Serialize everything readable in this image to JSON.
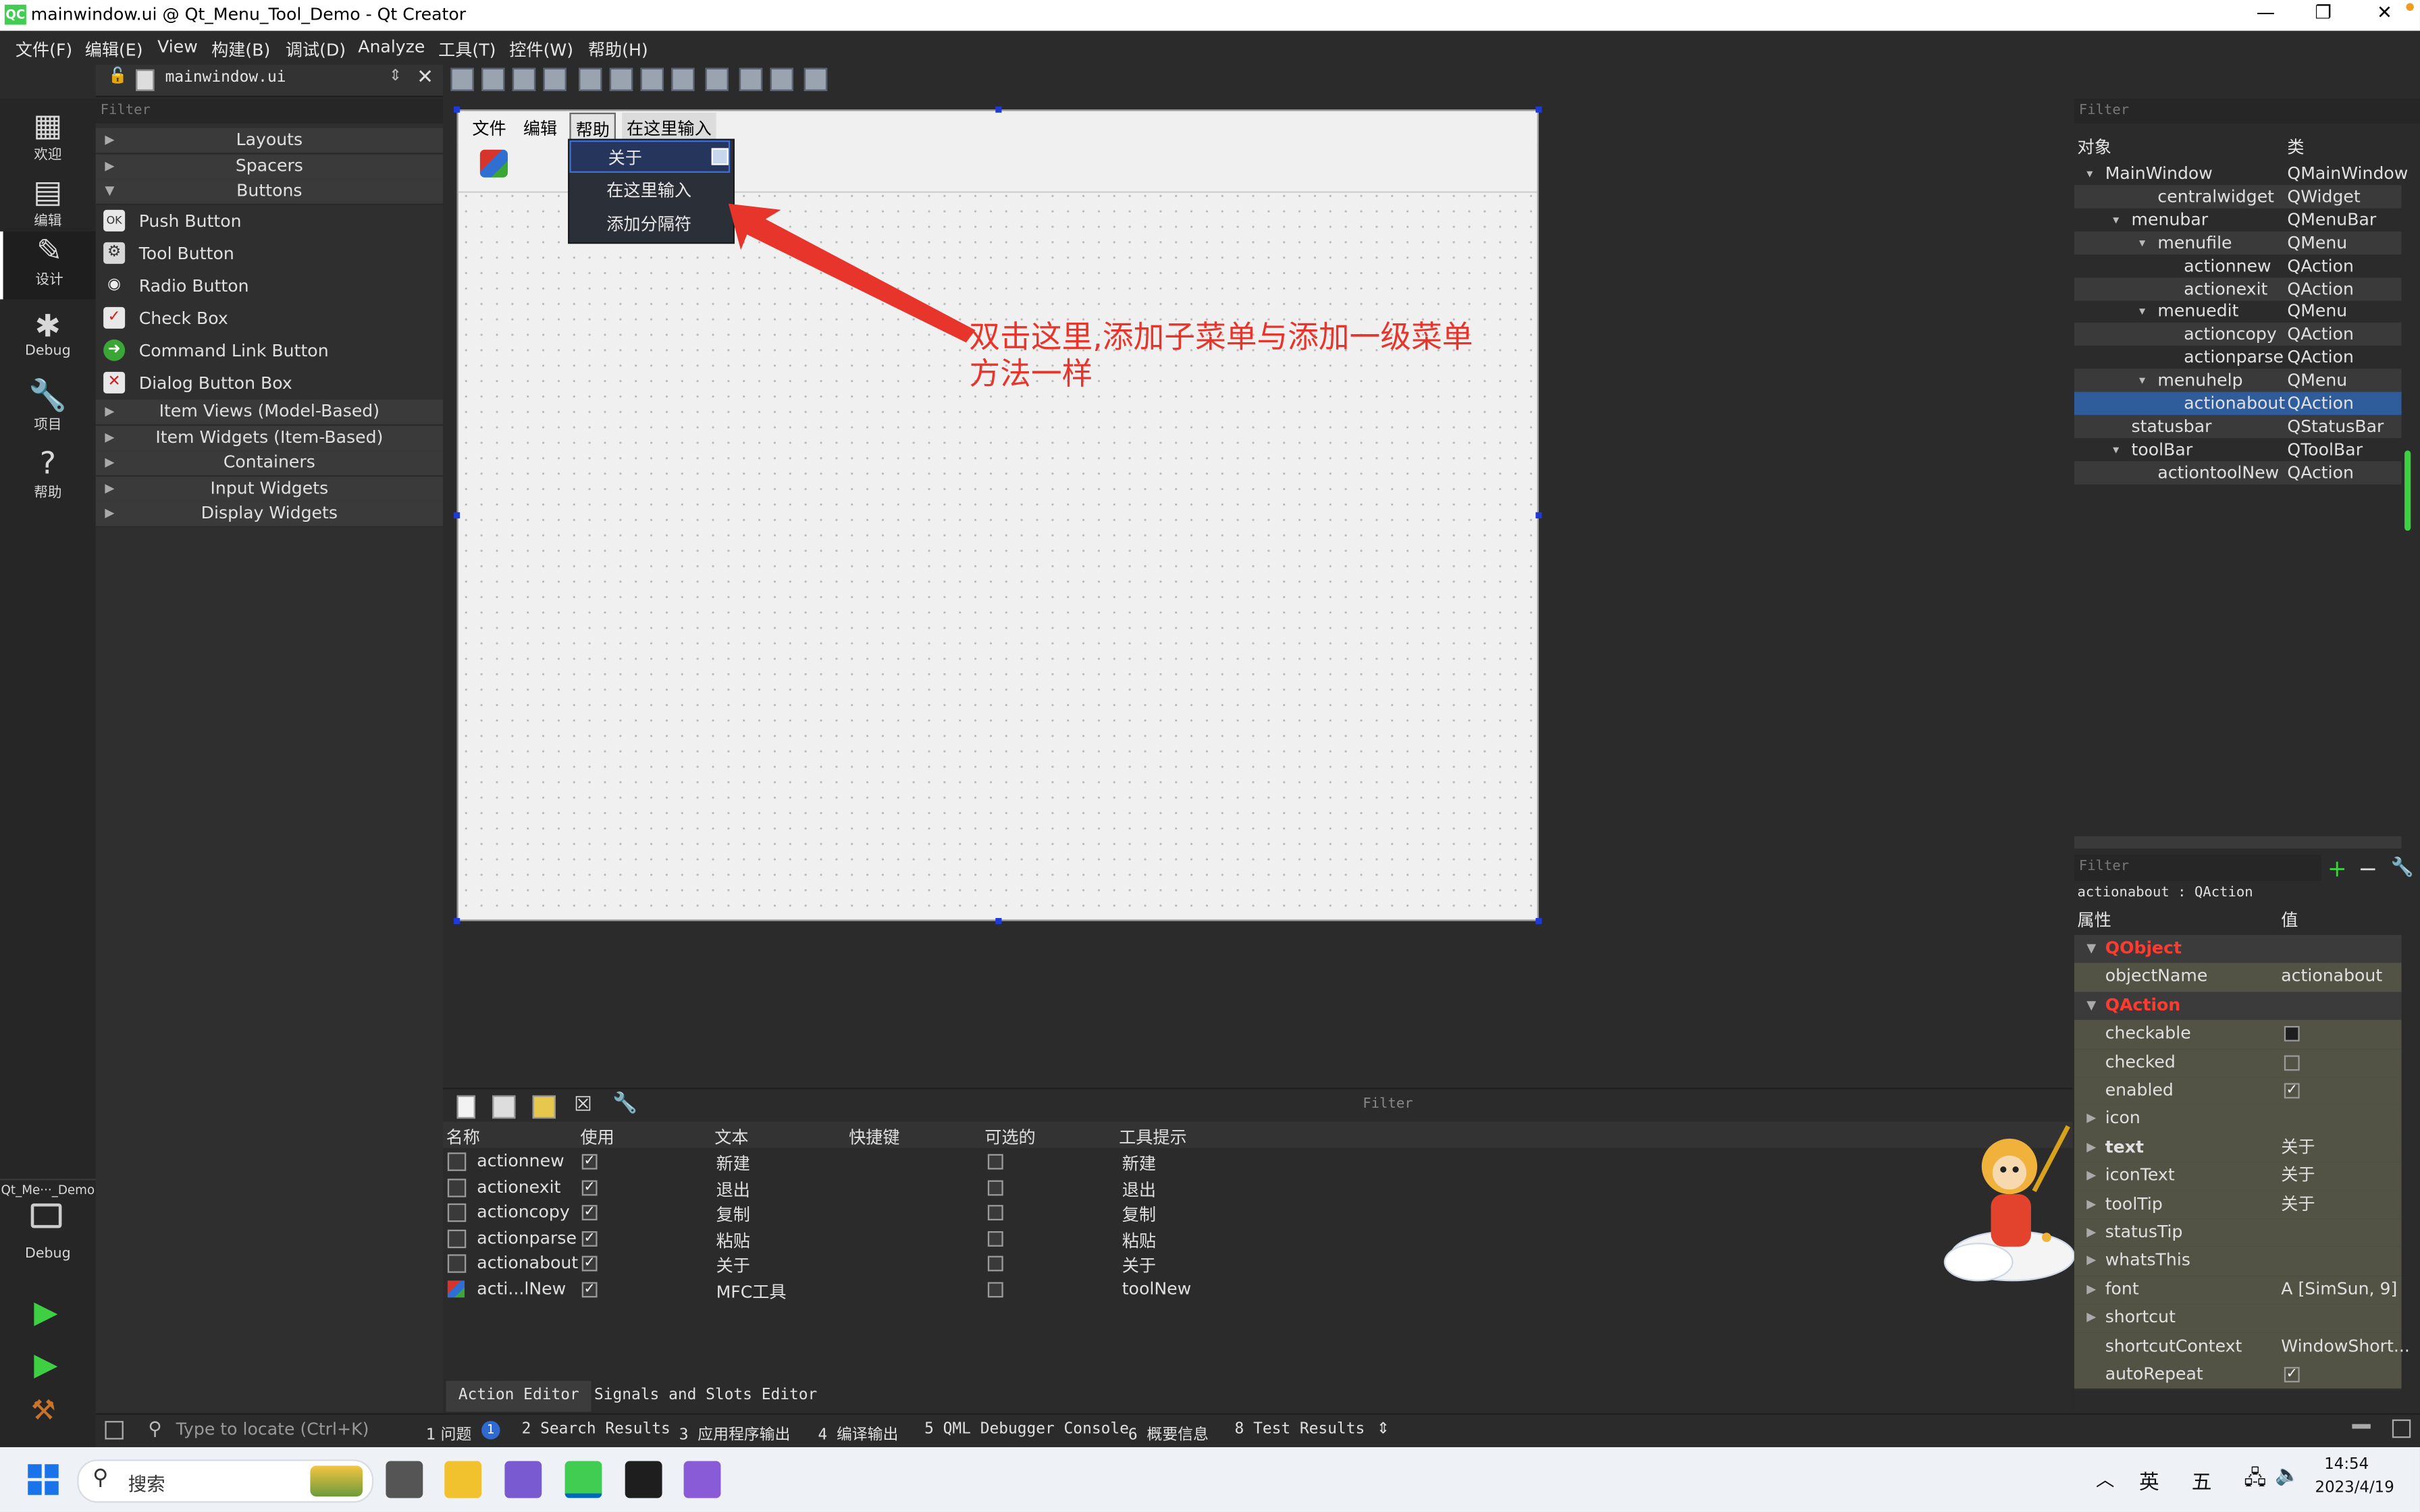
{
  "window": {
    "title": "mainwindow.ui @ Qt_Menu_Tool_Demo - Qt Creator",
    "controls": [
      "—",
      "❐",
      "✕"
    ]
  },
  "menubar": [
    "文件(F)",
    "编辑(E)",
    "View",
    "构建(B)",
    "调试(D)",
    "Analyze",
    "工具(T)",
    "控件(W)",
    "帮助(H)"
  ],
  "modes": [
    {
      "label": "欢迎",
      "icon": "grid-icon"
    },
    {
      "label": "编辑",
      "icon": "document-icon"
    },
    {
      "label": "设计",
      "icon": "pencil-icon"
    },
    {
      "label": "Debug",
      "icon": "bug-icon"
    },
    {
      "label": "项目",
      "icon": "wrench-icon"
    },
    {
      "label": "帮助",
      "icon": "question-icon"
    }
  ],
  "project_selector": {
    "name": "Qt_Me···_Demo",
    "build": "Debug"
  },
  "editor_file": "mainwindow.ui",
  "widget_box": {
    "filter_placeholder": "Filter",
    "categories_top": [
      "Layouts",
      "Spacers",
      "Buttons"
    ],
    "buttons": [
      "Push Button",
      "Tool Button",
      "Radio Button",
      "Check Box",
      "Command Link Button",
      "Dialog Button Box"
    ],
    "categories_bottom": [
      "Item Views (Model-Based)",
      "Item Widgets (Item-Based)",
      "Containers",
      "Input Widgets",
      "Display Widgets"
    ]
  },
  "form": {
    "menus": [
      "文件",
      "编辑",
      "帮助",
      "在这里输入"
    ],
    "dropdown": [
      "关于",
      "在这里输入",
      "添加分隔符"
    ]
  },
  "annotation": {
    "line1": "双击这里,添加子菜单与添加一级菜单",
    "line2": "方法一样"
  },
  "action_editor": {
    "filter_placeholder": "Filter",
    "columns": [
      "名称",
      "使用",
      "文本",
      "快捷键",
      "可选的",
      "工具提示"
    ],
    "rows": [
      {
        "name": "actionnew",
        "used": true,
        "text": "新建",
        "tooltip": "新建"
      },
      {
        "name": "actionexit",
        "used": true,
        "text": "退出",
        "tooltip": "退出"
      },
      {
        "name": "actioncopy",
        "used": true,
        "text": "复制",
        "tooltip": "复制"
      },
      {
        "name": "actionparse",
        "used": true,
        "text": "粘贴",
        "tooltip": "粘贴"
      },
      {
        "name": "actionabout",
        "used": true,
        "text": "关于",
        "tooltip": "关于"
      },
      {
        "name": "acti...lNew",
        "used": true,
        "text": "MFC工具",
        "tooltip": "toolNew"
      }
    ],
    "tabs": [
      "Action Editor",
      "Signals and Slots Editor"
    ]
  },
  "object_inspector": {
    "filter_placeholder": "Filter",
    "header": [
      "对象",
      "类"
    ],
    "rows": [
      {
        "name": "MainWindow",
        "cls": "QMainWindow",
        "indent": 0,
        "exp": "▾"
      },
      {
        "name": "centralwidget",
        "cls": "QWidget",
        "indent": 2,
        "exp": ""
      },
      {
        "name": "menubar",
        "cls": "QMenuBar",
        "indent": 1,
        "exp": "▾"
      },
      {
        "name": "menufile",
        "cls": "QMenu",
        "indent": 2,
        "exp": "▾"
      },
      {
        "name": "actionnew",
        "cls": "QAction",
        "indent": 3,
        "exp": ""
      },
      {
        "name": "actionexit",
        "cls": "QAction",
        "indent": 3,
        "exp": ""
      },
      {
        "name": "menuedit",
        "cls": "QMenu",
        "indent": 2,
        "exp": "▾"
      },
      {
        "name": "actioncopy",
        "cls": "QAction",
        "indent": 3,
        "exp": ""
      },
      {
        "name": "actionparse",
        "cls": "QAction",
        "indent": 3,
        "exp": ""
      },
      {
        "name": "menuhelp",
        "cls": "QMenu",
        "indent": 2,
        "exp": "▾"
      },
      {
        "name": "actionabout",
        "cls": "QAction",
        "indent": 3,
        "exp": ""
      },
      {
        "name": "statusbar",
        "cls": "QStatusBar",
        "indent": 1,
        "exp": ""
      },
      {
        "name": "toolBar",
        "cls": "QToolBar",
        "indent": 1,
        "exp": "▾"
      },
      {
        "name": "actiontoolNew",
        "cls": "QAction",
        "indent": 2,
        "exp": ""
      }
    ]
  },
  "property_editor": {
    "filter_placeholder": "Filter",
    "object_label": "actionabout : QAction",
    "header": [
      "属性",
      "值"
    ],
    "rows": [
      {
        "kind": "group",
        "name": "QObject"
      },
      {
        "kind": "prop",
        "name": "objectName",
        "value": "actionabout"
      },
      {
        "kind": "group",
        "name": "QAction"
      },
      {
        "kind": "check",
        "name": "checkable",
        "checked": false,
        "filled": true
      },
      {
        "kind": "check",
        "name": "checked",
        "checked": false,
        "filled": false
      },
      {
        "kind": "check",
        "name": "enabled",
        "checked": true
      },
      {
        "kind": "expand",
        "name": "icon",
        "value": ""
      },
      {
        "kind": "expand",
        "name": "text",
        "value": "关于",
        "bold": true
      },
      {
        "kind": "expand",
        "name": "iconText",
        "value": "关于"
      },
      {
        "kind": "expand",
        "name": "toolTip",
        "value": "关于"
      },
      {
        "kind": "expand",
        "name": "statusTip",
        "value": ""
      },
      {
        "kind": "expand",
        "name": "whatsThis",
        "value": ""
      },
      {
        "kind": "expand",
        "name": "font",
        "value": "A  [SimSun, 9]"
      },
      {
        "kind": "expand",
        "name": "shortcut",
        "value": ""
      },
      {
        "kind": "prop",
        "name": "shortcutContext",
        "value": "WindowShort..."
      },
      {
        "kind": "check",
        "name": "autoRepeat",
        "checked": true
      }
    ]
  },
  "statusbar": {
    "locate_placeholder": "Type to locate (Ctrl+K)",
    "panes": [
      "1 问题",
      "2 Search Results",
      "3 应用程序输出",
      "4 编译输出",
      "5 QML Debugger Console",
      "6 概要信息",
      "8 Test Results"
    ],
    "issues_count": "1"
  },
  "taskbar": {
    "search_placeholder": "搜索",
    "ime1": "英",
    "ime2": "五",
    "time": "14:54",
    "date": "2023/4/19"
  },
  "colors": {
    "accent": "#2f5d9c",
    "annotation": "#e8352b",
    "group_title": "#ff3b30"
  }
}
